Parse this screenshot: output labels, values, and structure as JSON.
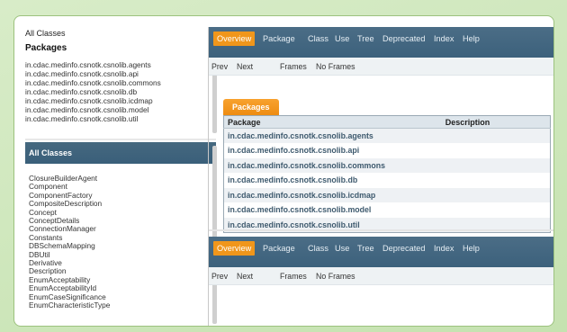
{
  "left_top": {
    "all_classes_link": "All Classes",
    "heading": "Packages",
    "packages": [
      "in.cdac.medinfo.csnotk.csnolib.agents",
      "in.cdac.medinfo.csnotk.csnolib.api",
      "in.cdac.medinfo.csnotk.csnolib.commons",
      "in.cdac.medinfo.csnotk.csnolib.db",
      "in.cdac.medinfo.csnotk.csnolib.icdmap",
      "in.cdac.medinfo.csnotk.csnolib.model",
      "in.cdac.medinfo.csnotk.csnolib.util"
    ]
  },
  "left_bottom": {
    "heading": "All Classes",
    "classes": [
      "ClosureBuilderAgent",
      "Component",
      "ComponentFactory",
      "CompositeDescription",
      "Concept",
      "ConceptDetails",
      "ConnectionManager",
      "Constants",
      "DBSchemaMapping",
      "DBUtil",
      "Derivative",
      "Description",
      "EnumAcceptability",
      "EnumAcceptabilityId",
      "EnumCaseSignificance",
      "EnumCharacteristicType"
    ]
  },
  "topnav": {
    "items": [
      "Overview",
      "Package",
      "Class",
      "Use",
      "Tree",
      "Deprecated",
      "Index",
      "Help"
    ]
  },
  "subnav": {
    "prev": "Prev",
    "next": "Next",
    "frames": "Frames",
    "no_frames": "No Frames"
  },
  "packages_table": {
    "tab_label": "Packages",
    "col_package": "Package",
    "col_description": "Description",
    "rows": [
      "in.cdac.medinfo.csnotk.csnolib.agents",
      "in.cdac.medinfo.csnotk.csnolib.api",
      "in.cdac.medinfo.csnotk.csnolib.commons",
      "in.cdac.medinfo.csnotk.csnolib.db",
      "in.cdac.medinfo.csnotk.csnolib.icdmap",
      "in.cdac.medinfo.csnotk.csnolib.model",
      "in.cdac.medinfo.csnotk.csnolib.util"
    ]
  },
  "colors": {
    "nav_bar": "#3c617c",
    "active_tab": "#f0961b",
    "page_background": "#c5e2b0"
  }
}
